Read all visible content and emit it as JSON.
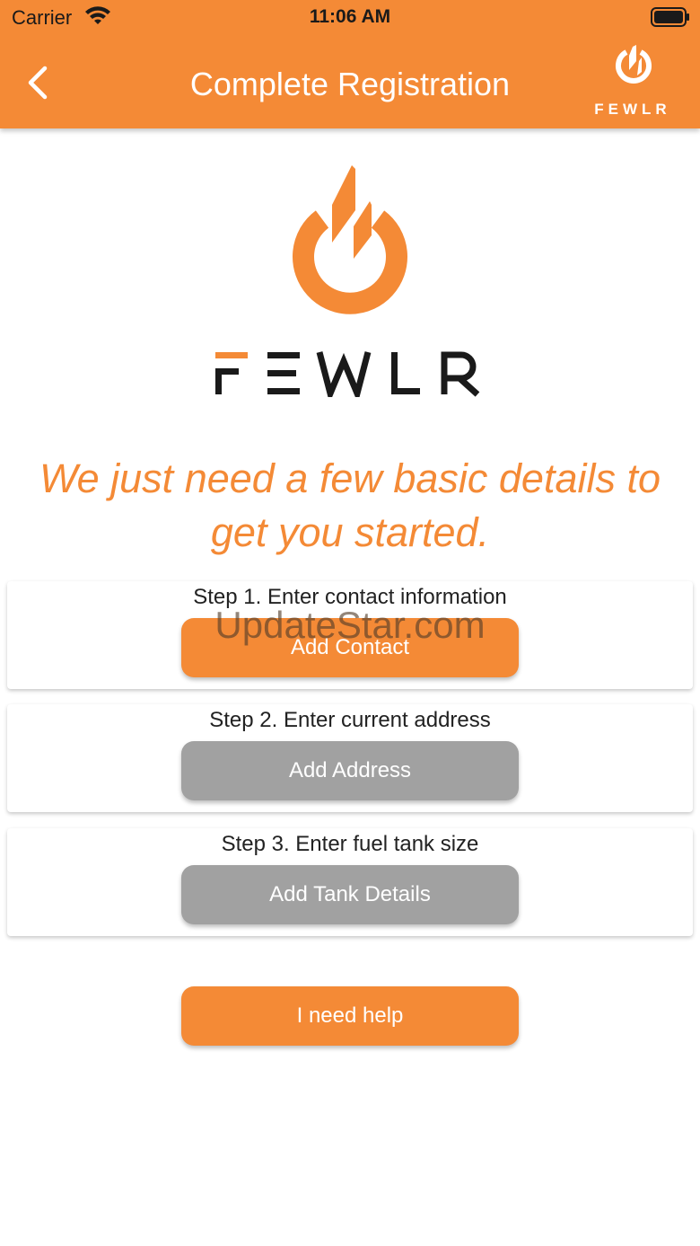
{
  "status_bar": {
    "carrier": "Carrier",
    "time": "11:06 AM"
  },
  "nav": {
    "title": "Complete Registration",
    "brand": "FEWLR"
  },
  "logo": {
    "wordmark": "FEWLR"
  },
  "tagline": {
    "line1": "We just need a few basic details to",
    "line2": "get you started."
  },
  "steps": [
    {
      "label": "Step 1. Enter contact information",
      "button": "Add Contact",
      "state": "active"
    },
    {
      "label": "Step 2. Enter current address",
      "button": "Add Address",
      "state": "disabled"
    },
    {
      "label": "Step 3. Enter fuel tank size",
      "button": "Add Tank Details",
      "state": "disabled"
    }
  ],
  "help_button": "I need help",
  "watermark": "UpdateStar.com",
  "colors": {
    "brand": "#F48A36",
    "disabled": "#A1A1A1",
    "text": "#222222",
    "wordmark": "#1A1A1A"
  }
}
